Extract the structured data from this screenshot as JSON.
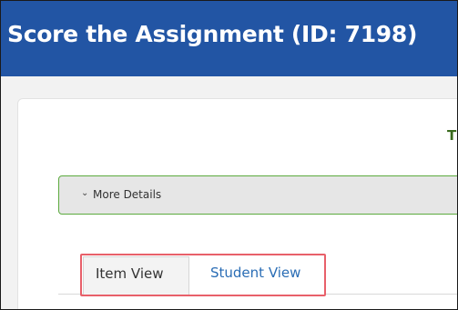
{
  "header": {
    "title": "Score the Assignment (ID: 7198)"
  },
  "main": {
    "truncated_heading": "T",
    "details": {
      "label": "More Details",
      "chevron": "chevron-down-icon"
    },
    "tabs": [
      {
        "label": "Item View",
        "selected": true
      },
      {
        "label": "Student View",
        "selected": false
      }
    ]
  },
  "colors": {
    "header_bg": "#2255a4",
    "details_border": "#5cab3f",
    "link": "#2a6db5",
    "highlight": "#e8606a"
  }
}
